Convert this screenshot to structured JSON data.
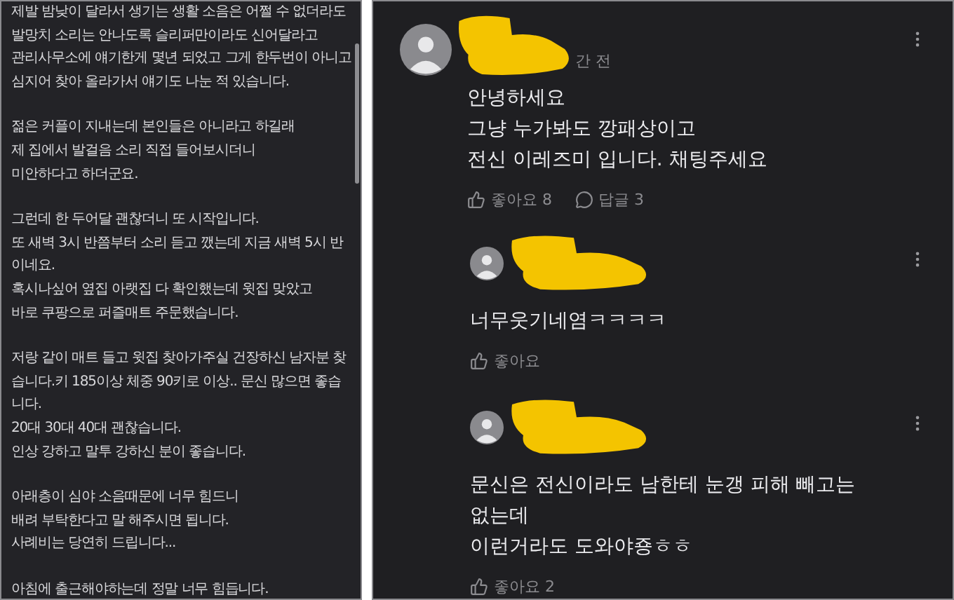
{
  "post": {
    "paragraphs": [
      [
        "제발 밤낮이 달라서 생기는 생활 소음은 어쩔 수 없더라도",
        "발망치 소리는 안나도록 슬리퍼만이라도 신어달라고",
        "관리사무소에 얘기한게 몇년 되었고 그게 한두번이 아니고",
        "심지어 찾아 올라가서 얘기도 나눈 적 있습니다."
      ],
      [
        "젊은 커플이 지내는데 본인들은 아니라고 하길래",
        "제 집에서 발걸음 소리 직접 들어보시더니",
        "미안하다고 하더군요."
      ],
      [
        "그런데 한 두어달 괜찮더니 또 시작입니다.",
        "또 새벽 3시 반쯤부터 소리 듣고 깼는데 지금 새벽 5시 반",
        "이네요.",
        "혹시나싶어 옆집 아랫집 다 확인했는데 윗집 맞았고",
        "바로 쿠팡으로 퍼즐매트 주문했습니다."
      ],
      [
        "저랑 같이 매트 들고 윗집 찾아가주실 건장하신 남자분 찾",
        "습니다.키 185이상 체중 90키로 이상.. 문신 많으면 좋습",
        "니다.",
        "20대 30대 40대 괜찮습니다.",
        "인상 강하고 말투 강하신 분이 좋습니다."
      ],
      [
        "아래층이 심야 소음때문에 너무 힘드니",
        "배려 부탁한다고 말 해주시면 됩니다.",
        "사례비는 당연히 드립니다..."
      ],
      [
        "아침에 출근해야하는데 정말 너무 힘듭니다."
      ]
    ]
  },
  "comments": [
    {
      "kind": "comment",
      "author_redacted": true,
      "time": "간 전",
      "lines": [
        "안녕하세요",
        "그냥 누가봐도 깡패상이고",
        "전신 이레즈미 입니다. 채팅주세요"
      ],
      "likes": "좋아요 8",
      "replies": "답글 3"
    },
    {
      "kind": "reply",
      "author_redacted": true,
      "lines": [
        "너무웃기네염ㅋㅋㅋㅋ"
      ],
      "likes": "좋아요"
    },
    {
      "kind": "reply",
      "author_redacted": true,
      "lines": [
        "문신은 전신이라도 남한테 눈갱 피해 빼고는",
        "없는데",
        "이런거라도 도와야죵ㅎㅎ"
      ],
      "likes": "좋아요 2"
    }
  ]
}
